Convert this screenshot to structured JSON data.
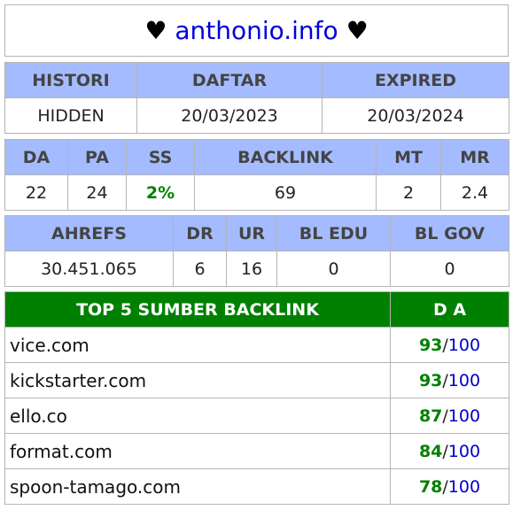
{
  "title": {
    "heart_left": "♥",
    "domain": "anthonio.info",
    "heart_right": "♥"
  },
  "history": {
    "headers": [
      "HISTORI",
      "DAFTAR",
      "EXPIRED"
    ],
    "values": [
      "HIDDEN",
      "20/03/2023",
      "20/03/2024"
    ]
  },
  "metrics": {
    "headers": [
      "DA",
      "PA",
      "SS",
      "BACKLINK",
      "MT",
      "MR"
    ],
    "values": [
      "22",
      "24",
      "2%",
      "69",
      "2",
      "2.4"
    ]
  },
  "ahrefs": {
    "headers": [
      "AHREFS",
      "DR",
      "UR",
      "BL EDU",
      "BL GOV"
    ],
    "values": [
      "30.451.065",
      "6",
      "16",
      "0",
      "0"
    ]
  },
  "backlinks": {
    "header_source": "TOP 5 SUMBER BACKLINK",
    "header_da": "D A",
    "max": "100",
    "rows": [
      {
        "site": "vice.com",
        "da": "93"
      },
      {
        "site": "kickstarter.com",
        "da": "93"
      },
      {
        "site": "ello.co",
        "da": "87"
      },
      {
        "site": "format.com",
        "da": "84"
      },
      {
        "site": "spoon-tamago.com",
        "da": "78"
      }
    ]
  },
  "colors": {
    "header_bg": "#a4bcff",
    "backlink_header_bg": "#008000",
    "link_blue": "#0000dd",
    "da_green": "#008000"
  }
}
